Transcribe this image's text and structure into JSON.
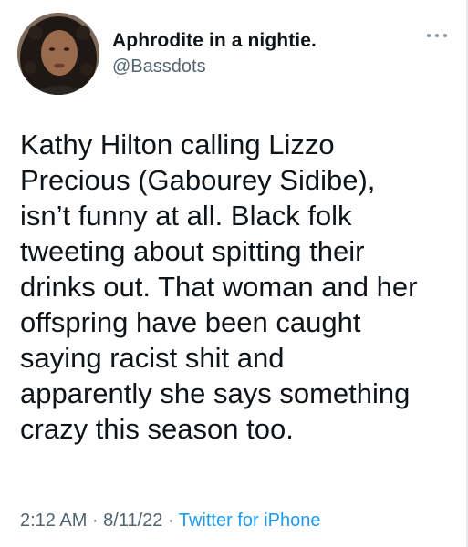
{
  "tweet": {
    "author": {
      "display_name": "Aphrodite in a nightie.",
      "handle": "@Bassdots",
      "avatar_icon": "profile-photo"
    },
    "menu_icon": "more-options-icon",
    "lines": [
      "Kathy Hilton calling Lizzo",
      "Precious (Gabourey Sidibe),",
      "isn’t funny at all. Black folk",
      "tweeting about spitting their",
      "drinks out. That woman and her",
      "offspring have been caught",
      "saying racist shit and",
      "apparently she says something",
      "crazy this season too."
    ],
    "time": "2:12 AM",
    "separator": " · ",
    "date": "8/11/22",
    "source": "Twitter for iPhone"
  },
  "colors": {
    "text": "#0f1419",
    "secondary_text": "#536471",
    "link": "#1d9bf0",
    "divider": "#e7e9ea"
  }
}
